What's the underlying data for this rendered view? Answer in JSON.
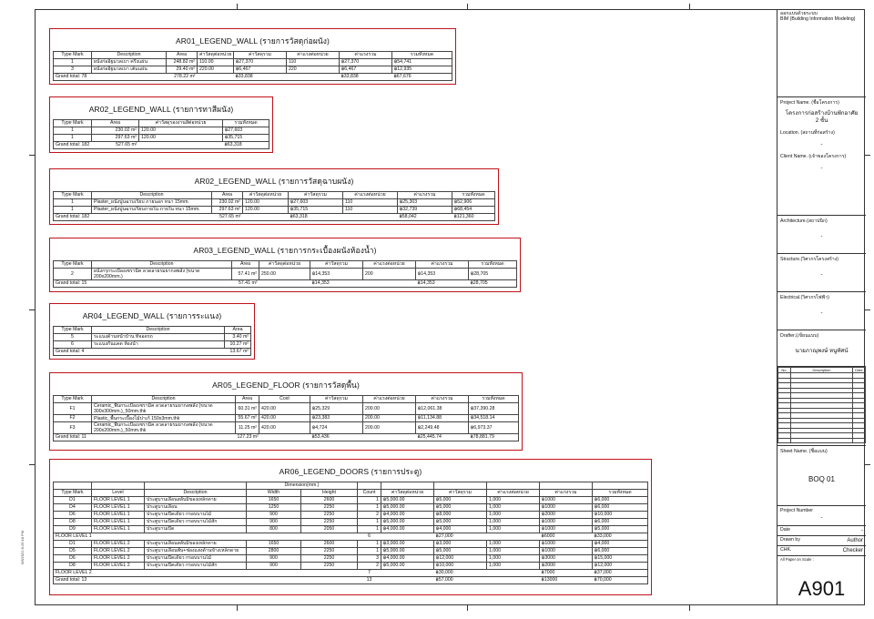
{
  "ar01": {
    "title": "AR01_LEGEND_WALL (รายการวัสดุก่อผนัง)",
    "headers": [
      "Type Mark",
      "Description",
      "Area",
      "ค่าวัสดุต่อหน่วย",
      "ค่าวัสดุรวม",
      "ค่าแรงต่อหน่วย",
      "ค่าแรงรวม",
      "รวมทั้งหมด"
    ],
    "rows": [
      [
        "1",
        "ผนังก่ออิฐมวลเบา ครึ่งแผ่น",
        "248.82 m²",
        "110.00",
        "฿27,370",
        "110",
        "฿27,370",
        "฿54,741"
      ],
      [
        "3",
        "ผนังก่ออิฐมวลเบา เต็มแผ่น",
        "29.40 m²",
        "220.00",
        "฿6,467",
        "220",
        "฿6,467",
        "฿12,935"
      ]
    ],
    "total": [
      "Grand total: 78",
      "",
      "278.22 m²",
      "",
      "฿33,838",
      "",
      "฿33,838",
      "฿67,676"
    ]
  },
  "ar02a": {
    "title": "AR02_LEGEND_WALL (รายการทาสีผนัง)",
    "headers": [
      "Type Mark",
      "Area",
      "ค่าวัสดุรองงานสีต่อหน่วย",
      "รวมทั้งหมด"
    ],
    "rows": [
      [
        "1",
        "230.02 m²",
        "120.00",
        "฿27,603"
      ],
      [
        "1",
        "297.63 m²",
        "120.00",
        "฿35,715"
      ]
    ],
    "total": [
      "Grand total: 182",
      "527.65 m²",
      "",
      "฿63,318"
    ]
  },
  "ar02b": {
    "title": "AR02_LEGEND_WALL (รายการวัสดุฉาบผนัง)",
    "headers": [
      "Type Mark",
      "Description",
      "Area",
      "ค่าวัสดุต่อหน่วย",
      "ค่าวัสดุรวม",
      "ค่าแรงต่อหน่วย",
      "ค่าแรงรวม",
      "รวมทั้งหมด"
    ],
    "rows": [
      [
        "1",
        "Plaster_ผนังปูนฉาบเรียบ ภายนอก หนา 15mm.",
        "230.02 m²",
        "120.00",
        "฿27,603",
        "110",
        "฿25,303",
        "฿52,906"
      ],
      [
        "1",
        "Plaster_ผนังปูนฉาบเรียบภายใน ภายใน หนา 15mm.",
        "297.63 m²",
        "120.00",
        "฿35,715",
        "110",
        "฿32,739",
        "฿68,454"
      ]
    ],
    "total": [
      "Grand total: 182",
      "",
      "527.65 m²",
      "",
      "฿63,318",
      "",
      "฿58,042",
      "฿121,360"
    ]
  },
  "ar03": {
    "title": "AR03_LEGEND_WALL (รายการกระเบื้องผนังห้องน้ำ)",
    "headers": [
      "Type Mark",
      "Description",
      "Area",
      "ค่าวัสดุต่อหน่วย",
      "ค่าวัสดุรวม",
      "ค่าแรงต่อหน่วย",
      "ค่าแรงรวม",
      "รวมทั้งหมด"
    ],
    "rows": [
      [
        "2",
        "ผนังกรุกระเบื้องเซรามิค ลวดลายรมยากลพลัง (ขนาด 200x200mm.)",
        "57.41 m²",
        "250.00",
        "฿14,353",
        "200",
        "฿14,353",
        "฿28,705"
      ]
    ],
    "total": [
      "Grand total: 15",
      "",
      "57.41 m²",
      "",
      "฿14,353",
      "",
      "฿14,353",
      "฿28,705"
    ]
  },
  "ar04": {
    "title": "AR04_LEGEND_WALL (รายการระแนง)",
    "headers": [
      "Type Mark",
      "Description",
      "Area"
    ],
    "rows": [
      [
        "5",
        "ระแนงด้านหน้าบ้าน ที่จอดรถ",
        "3.40 m²"
      ],
      [
        "6",
        "ระแนงกันแดด ห้องน้ำ",
        "10.27 m²"
      ]
    ],
    "total": [
      "Grand total: 4",
      "",
      "13.67 m²"
    ]
  },
  "ar05": {
    "title": "AR05_LEGEND_FLOOR (รายการวัสดุพื้น)",
    "headers": [
      "Type Mark",
      "Description",
      "Area",
      "Cost",
      "ค่าวัสดุรวม",
      "ค่าแรงต่อหน่วย",
      "ค่าแรงรวม",
      "รวมทั้งหมด"
    ],
    "rows": [
      [
        "F1",
        "Ceramic_พื้นกระเบื้องเซรามิค ลวดลายรมยากลพลัง (ขนาด 300x300mm.)_50mm.thk",
        "60.31 m²",
        "420.00",
        "฿25,329",
        "200.00",
        "฿12,061.38",
        "฿37,390.28"
      ],
      [
        "F2",
        "Plastic_พื้นกระเบื้องไม้ปาเก้ 150x3mm.thk",
        "55.67 m²",
        "420.00",
        "฿23,383",
        "200.00",
        "฿11,134.88",
        "฿34,518.14"
      ],
      [
        "F3",
        "Ceramic_พื้นกระเบื้องเซรามิค ลวดลายรมยากลพลัง (ขนาด 200x200mm.)_50mm.thk",
        "11.25 m²",
        "420.00",
        "฿4,724",
        "200.00",
        "฿2,249.48",
        "฿6,973.37"
      ]
    ],
    "total": [
      "Grand total: 11",
      "",
      "127.23 m²",
      "",
      "฿53,436",
      "",
      "฿25,445.74",
      "฿78,881.79"
    ]
  },
  "ar06": {
    "title": "AR06_LEGEND_DOORS (รายการประตู)",
    "dimension_header": "Dimension(mm.)",
    "headers": [
      "Type Mark",
      "Level",
      "Description",
      "Width",
      "Height",
      "Count",
      "ค่าวัสดุต่อหน่วย",
      "ค่าวัสดุรวม",
      "ค่าแรงต่อหน่วย",
      "ค่าแรงรวม",
      "รวมทั้งหมด"
    ],
    "group1": [
      [
        "D1",
        "FLOOR LEVEL 1",
        "ประตูบานเลื่อนสลับมีของเหล็กดาย",
        "1650",
        "2600",
        "1",
        "฿5,000.00",
        "฿5,000",
        "1,000",
        "฿1000",
        "฿6,000"
      ],
      [
        "D4",
        "FLOOR LEVEL 1",
        "ประตูบานเลื่อน",
        "1250",
        "2250",
        "1",
        "฿5,000.00",
        "฿5,000",
        "1,000",
        "฿1000",
        "฿6,000"
      ],
      [
        "D6",
        "FLOOR LEVEL 1",
        "ประตูบานเปิดเดี่ยว กรอบบานไม้",
        "900",
        "2250",
        "2",
        "฿4,000.00",
        "฿8,000",
        "1,000",
        "฿2000",
        "฿10,000"
      ],
      [
        "D8",
        "FLOOR LEVEL 1",
        "ประตูบานเปิดเดี่ยว กรอบบานไม้สัก",
        "900",
        "2250",
        "1",
        "฿5,000.00",
        "฿5,000",
        "1,000",
        "฿1000",
        "฿6,000"
      ],
      [
        "D9",
        "FLOOR LEVEL 1",
        "ประตูบานเปิด",
        "800",
        "2050",
        "1",
        "฿4,000.00",
        "฿4,000",
        "1,000",
        "฿1000",
        "฿5,000"
      ]
    ],
    "group1_total": [
      "FLOOR LEVEL 1: 6",
      "",
      "",
      "",
      "",
      "6",
      "",
      "฿27,000",
      "",
      "฿6000",
      "฿33,000"
    ],
    "group2": [
      [
        "D1",
        "FLOOR LEVEL 2",
        "ประตูบานเลื่อนสลับมีของเหล็กดาย",
        "1650",
        "2600",
        "1",
        "฿3,000.00",
        "฿3,000",
        "1,000",
        "฿1000",
        "฿4,000"
      ],
      [
        "D5",
        "FLOOR LEVEL 2",
        "ประตูบานเลื่อนพับ+ช่องแสงด้านข้างเหล็กดาย",
        "2800",
        "2250",
        "1",
        "฿5,000.00",
        "฿5,000",
        "1,000",
        "฿1000",
        "฿6,000"
      ],
      [
        "D6",
        "FLOOR LEVEL 2",
        "ประตูบานเปิดเดี่ยว กรอบบานไม้",
        "900",
        "2250",
        "3",
        "฿4,000.00",
        "฿12,000",
        "1,000",
        "฿3000",
        "฿15,000"
      ],
      [
        "D8",
        "FLOOR LEVEL 2",
        "ประตูบานเปิดเดี่ยว กรอบบานไม้สัก",
        "900",
        "2250",
        "2",
        "฿5,000.00",
        "฿10,000",
        "1,000",
        "฿2000",
        "฿12,000"
      ]
    ],
    "group2_total": [
      "FLOOR LEVEL 2: 7",
      "",
      "",
      "",
      "",
      "7",
      "",
      "฿30,000",
      "",
      "฿7000",
      "฿37,000"
    ],
    "total": [
      "Grand total: 13",
      "",
      "",
      "",
      "",
      "13",
      "",
      "฿57,000",
      "",
      "฿13000",
      "฿70,000"
    ]
  },
  "titleblock": {
    "header": "ออกแบบด้วยระบบ\nBIM (Building Information Modeling)",
    "project_name_label": "Project Name. (ชื่อโครงการ)",
    "project_name": "โครงการก่อสร้างบ้านพักอาศัย\n2 ชั้น",
    "location_label": "Location. (สถานที่ก่อสร้าง)",
    "location": "-",
    "client_label": "Client Name. (เจ้าของโครงการ)",
    "client": "-",
    "architecture_label": "Architecture.(สถาปนิก)",
    "architecture": "-",
    "structure_label": "Structure.(วิศวกรโครงสร้าง)",
    "structure": "-",
    "electrical_label": "Electrical.(วิศวกรไฟฟ้า)",
    "electrical": "-",
    "drafter_label": "Drafter.(เขียนแบบ)",
    "drafter": "นายภาณุพงษ์ หนูทัศน์",
    "rev_headers": [
      "No.",
      "Description",
      "Date"
    ],
    "sheet_name_label": "Sheet Name. (ชื่อแบบ)",
    "sheet_name": "BOQ 01",
    "project_number_label": "Project Number",
    "project_number": "-",
    "date_label": "Date",
    "date": "-",
    "drawn_by_label": "Drawn by",
    "drawn_by": "Author",
    "chk_label": "CHK.",
    "chk": "Checker",
    "scale_label": "All Paper on Scale :",
    "sheet_number": "A901"
  },
  "side_stamp": "9/6/2022 8:26:18 PM"
}
